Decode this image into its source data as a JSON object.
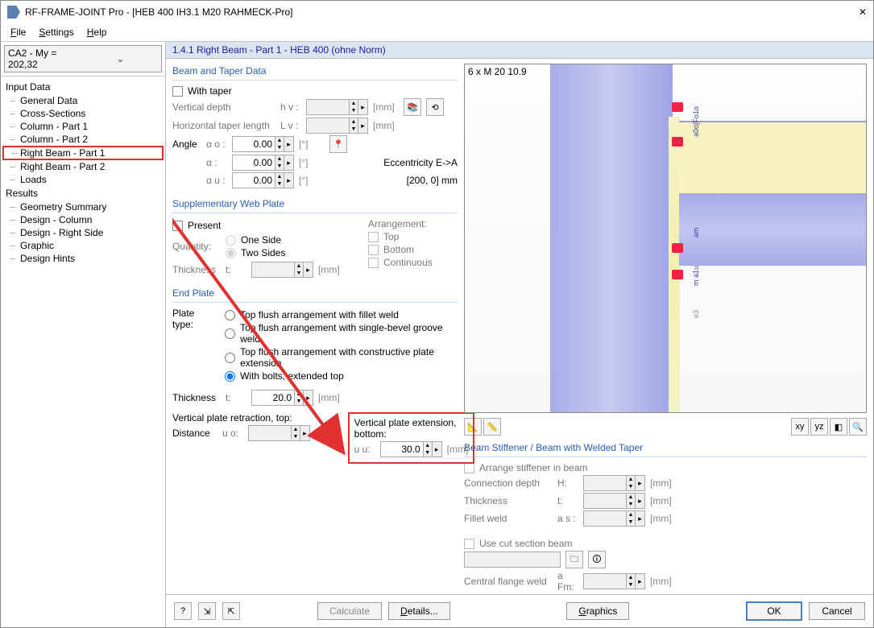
{
  "window": {
    "title": "RF-FRAME-JOINT Pro - [HEB 400 IH3.1 M20 RAHMECK-Pro]"
  },
  "menu": {
    "file": "File",
    "settings": "Settings",
    "help": "Help"
  },
  "combo": "CA2 - My = 202,32",
  "tree": {
    "input": "Input Data",
    "items1": [
      "General Data",
      "Cross-Sections",
      "Column - Part 1",
      "Column - Part 2",
      "Right Beam - Part 1",
      "Right Beam - Part 2",
      "Loads"
    ],
    "results": "Results",
    "items2": [
      "Geometry Summary",
      "Design - Column",
      "Design - Right Side",
      "Graphic",
      "Design Hints"
    ]
  },
  "panel_title": "1.4.1 Right Beam - Part 1 - HEB 400 (ohne Norm)",
  "viewport_label": "6 x M 20 10.9",
  "beam_taper": {
    "title": "Beam and Taper Data",
    "with_taper": "With taper",
    "vdepth": "Vertical depth",
    "vdepth_sym": "h v :",
    "hlen": "Horizontal taper length",
    "hlen_sym": "L v :",
    "angle": "Angle",
    "ao": "α o :",
    "a": "α :",
    "au": "α u :",
    "val_ao": "0.00",
    "val_a": "0.00",
    "val_au": "0.00",
    "deg": "[°]",
    "mm": "[mm]",
    "ecc": "Eccentricity E->A",
    "ecc_val": "[200, 0] mm"
  },
  "web_plate": {
    "title": "Supplementary Web Plate",
    "present": "Present",
    "quantity": "Quantity:",
    "one": "One Side",
    "two": "Two Sides",
    "thickness": "Thickness",
    "t": "t:",
    "arrangement": "Arrangement:",
    "top": "Top",
    "bottom": "Bottom",
    "continuous": "Continuous"
  },
  "end_plate": {
    "title": "End Plate",
    "plate_type": "Plate type:",
    "opt1": "Top flush arrangement with fillet weld",
    "opt2": "Top flush arrangement with single-bevel groove weld",
    "opt3": "Top flush arrangement with constructive plate extension",
    "opt4": "With bolts, extended top",
    "thickness": "Thickness",
    "t": "t:",
    "t_val": "20.0",
    "retraction": "Vertical plate retraction, top:",
    "distance": "Distance",
    "uo": "u o:",
    "extension": "Vertical plate extension, bottom:",
    "uu": "u u:",
    "uu_val": "30.0"
  },
  "stiffener": {
    "title": "Beam Stiffener / Beam with Welded Taper",
    "arrange": "Arrange stiffener in beam",
    "conn": "Connection depth",
    "H": "H:",
    "thickness": "Thickness",
    "t": "t:",
    "fillet": "Fillet weld",
    "as": "a s :",
    "usecut": "Use cut section beam",
    "cfw": "Central flange weld",
    "afm": "a Fm:"
  },
  "buttons": {
    "calculate": "Calculate",
    "details": "Details...",
    "graphics": "Graphics",
    "ok": "OK",
    "cancel": "Cancel"
  }
}
